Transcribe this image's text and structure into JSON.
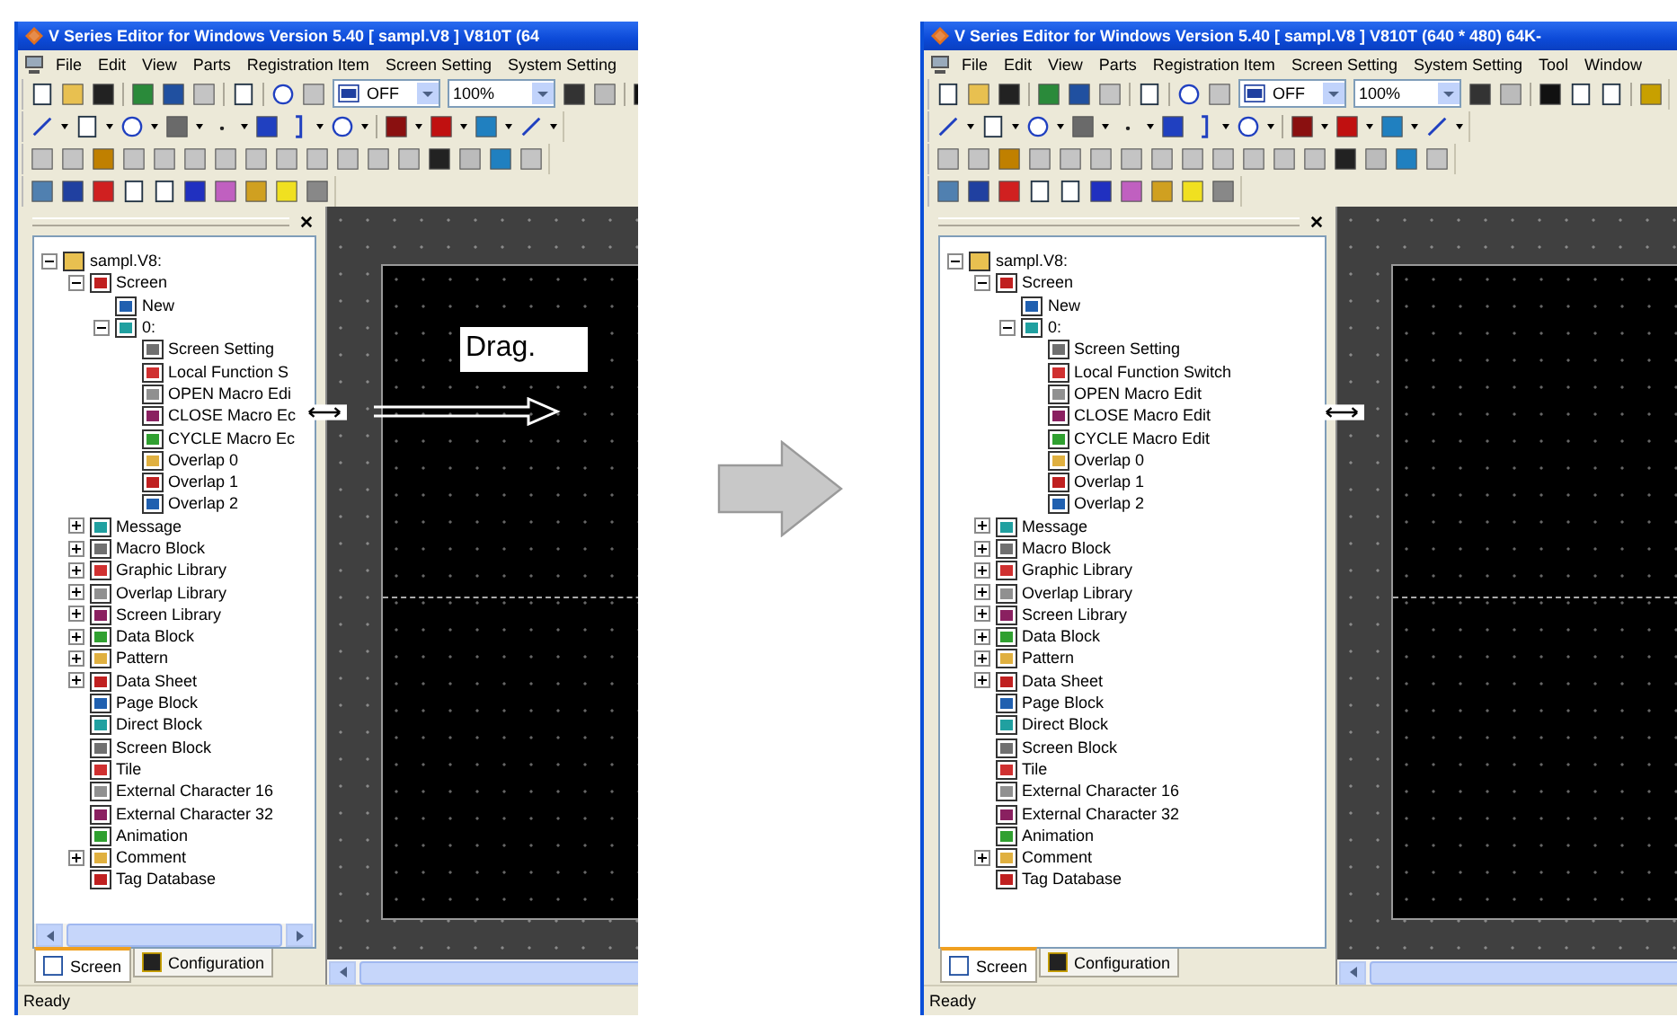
{
  "windows": [
    {
      "title": "V Series Editor for Windows Version 5.40 [ sampl.V8 ] V810T (64",
      "menu": [
        "File",
        "Edit",
        "View",
        "Parts",
        "Registration Item",
        "Screen Setting",
        "System Setting"
      ],
      "combos": [
        "OFF",
        "100%"
      ],
      "tree": [
        {
          "label": "sampl.V8:",
          "expanded": true,
          "children": [
            {
              "label": "Screen",
              "expanded": true,
              "children": [
                {
                  "label": "New"
                },
                {
                  "label": "0:",
                  "expanded": true,
                  "children": [
                    {
                      "label": "Screen Setting"
                    },
                    {
                      "label": "Local Function S"
                    },
                    {
                      "label": "OPEN Macro Edi"
                    },
                    {
                      "label": "CLOSE Macro Ec"
                    },
                    {
                      "label": "CYCLE Macro Ec"
                    },
                    {
                      "label": "Overlap 0"
                    },
                    {
                      "label": "Overlap 1"
                    },
                    {
                      "label": "Overlap 2"
                    }
                  ]
                }
              ]
            },
            {
              "label": "Message",
              "expanded": false
            },
            {
              "label": "Macro Block",
              "expanded": false
            },
            {
              "label": "Graphic Library",
              "expanded": false
            },
            {
              "label": "Overlap Library",
              "expanded": false
            },
            {
              "label": "Screen Library",
              "expanded": false
            },
            {
              "label": "Data Block",
              "expanded": false
            },
            {
              "label": "Pattern",
              "expanded": false
            },
            {
              "label": "Data Sheet",
              "expanded": false
            },
            {
              "label": "Page Block"
            },
            {
              "label": "Direct Block"
            },
            {
              "label": "Screen Block"
            },
            {
              "label": "Tile"
            },
            {
              "label": "External Character 16"
            },
            {
              "label": "External Character 32"
            },
            {
              "label": "Animation"
            },
            {
              "label": "Comment",
              "expanded": false
            },
            {
              "label": "Tag Database"
            }
          ]
        }
      ],
      "tree_scrollbar": true,
      "tabs": [
        {
          "label": "Screen",
          "selected": true
        },
        {
          "label": "Configuration",
          "selected": false
        }
      ],
      "drag_hint": "Drag.",
      "status": "Ready"
    },
    {
      "title": "V Series Editor for Windows Version 5.40 [ sampl.V8 ] V810T (640 * 480) 64K-",
      "menu": [
        "File",
        "Edit",
        "View",
        "Parts",
        "Registration Item",
        "Screen Setting",
        "System Setting",
        "Tool",
        "Window"
      ],
      "combos": [
        "OFF",
        "100%"
      ],
      "tree": [
        {
          "label": "sampl.V8:",
          "expanded": true,
          "children": [
            {
              "label": "Screen",
              "expanded": true,
              "children": [
                {
                  "label": "New"
                },
                {
                  "label": "0:",
                  "expanded": true,
                  "children": [
                    {
                      "label": "Screen Setting"
                    },
                    {
                      "label": "Local Function Switch"
                    },
                    {
                      "label": "OPEN Macro Edit"
                    },
                    {
                      "label": "CLOSE Macro Edit"
                    },
                    {
                      "label": "CYCLE Macro Edit"
                    },
                    {
                      "label": "Overlap 0"
                    },
                    {
                      "label": "Overlap 1"
                    },
                    {
                      "label": "Overlap 2"
                    }
                  ]
                }
              ]
            },
            {
              "label": "Message",
              "expanded": false
            },
            {
              "label": "Macro Block",
              "expanded": false
            },
            {
              "label": "Graphic Library",
              "expanded": false
            },
            {
              "label": "Overlap Library",
              "expanded": false
            },
            {
              "label": "Screen Library",
              "expanded": false
            },
            {
              "label": "Data Block",
              "expanded": false
            },
            {
              "label": "Pattern",
              "expanded": false
            },
            {
              "label": "Data Sheet",
              "expanded": false
            },
            {
              "label": "Page Block"
            },
            {
              "label": "Direct Block"
            },
            {
              "label": "Screen Block"
            },
            {
              "label": "Tile"
            },
            {
              "label": "External Character 16"
            },
            {
              "label": "External Character 32"
            },
            {
              "label": "Animation"
            },
            {
              "label": "Comment",
              "expanded": false
            },
            {
              "label": "Tag Database"
            }
          ]
        }
      ],
      "tree_scrollbar": false,
      "tabs": [
        {
          "label": "Screen",
          "selected": true
        },
        {
          "label": "Configuration",
          "selected": false
        }
      ],
      "status": "Ready"
    }
  ]
}
